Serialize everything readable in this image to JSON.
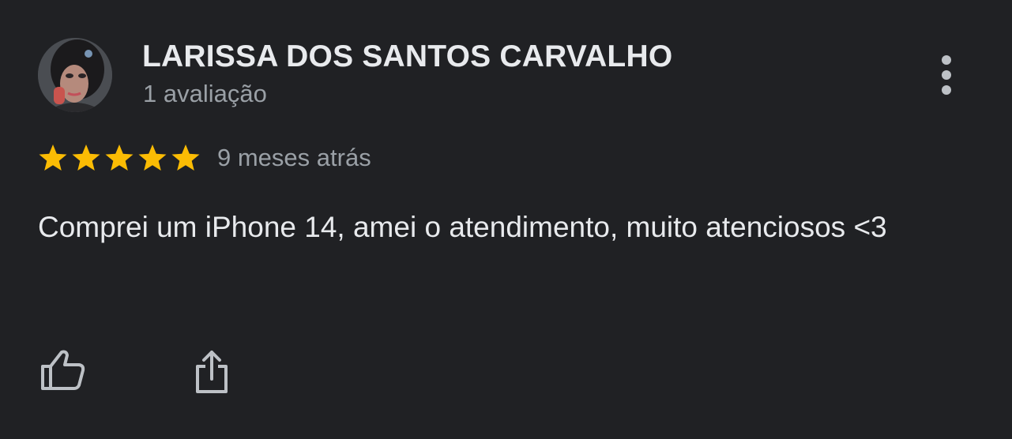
{
  "review": {
    "reviewer_name": "LARISSA DOS SANTOS CARVALHO",
    "review_count": "1 avaliação",
    "rating": 5,
    "rating_max": 5,
    "date": "9 meses atrás",
    "text": "Comprei um iPhone 14, amei o atendimento, muito atenciosos <3"
  },
  "icons": {
    "more": "more-vertical-icon",
    "star": "star-icon",
    "like": "thumb-up-icon",
    "share": "share-icon"
  },
  "colors": {
    "background": "#202124",
    "primary_text": "#e8eaed",
    "secondary_text": "#9aa0a6",
    "star": "#fbbc04",
    "icon": "#bdc1c6"
  }
}
